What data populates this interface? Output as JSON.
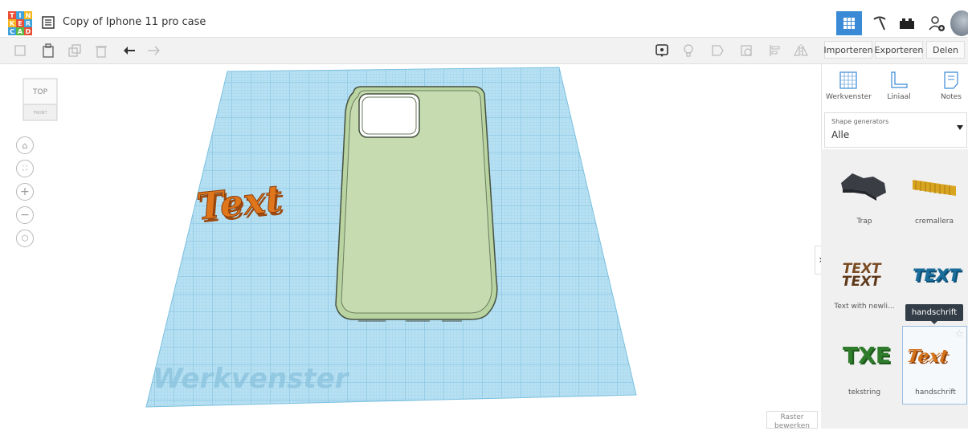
{
  "app": {
    "logo_letters": [
      "T",
      "I",
      "N",
      "K",
      "E",
      "R",
      "C",
      "A",
      "D"
    ],
    "document_title": "Copy of Iphone 11 pro case"
  },
  "toolbar": {
    "import_label": "Importeren",
    "export_label": "Exporteren",
    "share_label": "Delen"
  },
  "viewcube": {
    "top_label": "TOP",
    "front_label": "FRONT"
  },
  "workplane": {
    "watermark": "Werkvenster"
  },
  "right_panel": {
    "tools": [
      {
        "label": "Werkvenster",
        "icon": "workplane-icon"
      },
      {
        "label": "Liniaal",
        "icon": "ruler-icon"
      },
      {
        "label": "Notes",
        "icon": "note-icon"
      }
    ],
    "shape_generators": {
      "label": "Shape generators",
      "value": "Alle"
    },
    "shapes": [
      {
        "label": "Trap",
        "color": "#3a3d44"
      },
      {
        "label": "cremallera",
        "color": "#d9a520"
      },
      {
        "label": "Text with newli...",
        "color": "#7a4a22"
      },
      {
        "label": "",
        "color": "#1b6e9c"
      },
      {
        "label": "tekstring",
        "color": "#2f7d2c"
      },
      {
        "label": "handschrift",
        "color": "#d4731b"
      }
    ],
    "tooltip": "handschrift"
  },
  "raster": {
    "line1": "Raster",
    "line2": "bewerken"
  },
  "colors": {
    "accent": "#3b8ad6",
    "grid": "#a9d8ee",
    "case": "#c6dcb0",
    "text_shape": "#e0761c"
  }
}
